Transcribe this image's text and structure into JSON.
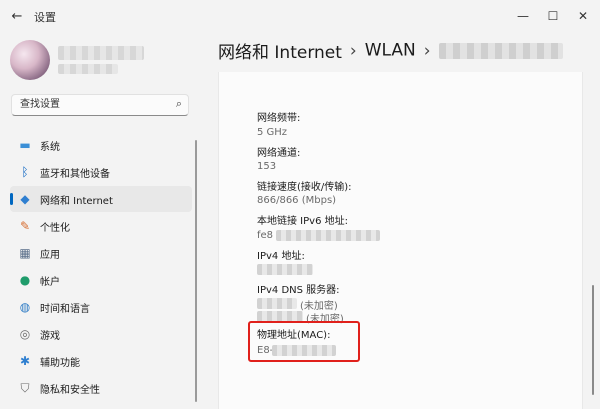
{
  "window": {
    "title": "设置",
    "back_glyph": "←",
    "min_glyph": "—",
    "max_glyph": "☐",
    "close_glyph": "✕"
  },
  "search": {
    "placeholder": "查找设置"
  },
  "sidebar": {
    "items": [
      {
        "label": "系统",
        "icon": "monitor-icon",
        "glyph": "▬",
        "color": "#3b8fd6",
        "selected": false
      },
      {
        "label": "蓝牙和其他设备",
        "icon": "bluetooth-icon",
        "glyph": "ᛒ",
        "color": "#0a64c2",
        "selected": false
      },
      {
        "label": "网络和 Internet",
        "icon": "wifi-icon",
        "glyph": "◆",
        "color": "#2f7fd0",
        "selected": true
      },
      {
        "label": "个性化",
        "icon": "brush-icon",
        "glyph": "✎",
        "color": "#d56a2c",
        "selected": false
      },
      {
        "label": "应用",
        "icon": "apps-icon",
        "glyph": "▦",
        "color": "#5a6f8a",
        "selected": false
      },
      {
        "label": "帐户",
        "icon": "person-icon",
        "glyph": "●",
        "color": "#1f9c6b",
        "selected": false
      },
      {
        "label": "时间和语言",
        "icon": "globe-clock-icon",
        "glyph": "◍",
        "color": "#2e7bc4",
        "selected": false
      },
      {
        "label": "游戏",
        "icon": "gamepad-icon",
        "glyph": "◎",
        "color": "#6b6b6b",
        "selected": false
      },
      {
        "label": "辅助功能",
        "icon": "accessibility-icon",
        "glyph": "✱",
        "color": "#2f7fd0",
        "selected": false
      },
      {
        "label": "隐私和安全性",
        "icon": "shield-icon",
        "glyph": "⛉",
        "color": "#6a6a6a",
        "selected": false
      }
    ]
  },
  "breadcrumb": {
    "part1": "网络和 Internet",
    "sep": "›",
    "part2": "WLAN"
  },
  "details": {
    "band_label": "网络频带:",
    "band_value": "5 GHz",
    "channel_label": "网络通道:",
    "channel_value": "153",
    "speed_label": "链接速度(接收/传输):",
    "speed_value": "866/866 (Mbps)",
    "ipv6_label": "本地链接 IPv6 地址:",
    "ipv6_value": "fe8",
    "ipv4_label": "IPv4 地址:",
    "dns_label": "IPv4 DNS 服务器:",
    "dns_value1": "(未加密)",
    "dns_value2": "(未加密)",
    "mac_label": "物理地址(MAC):",
    "mac_value": "E8-"
  }
}
